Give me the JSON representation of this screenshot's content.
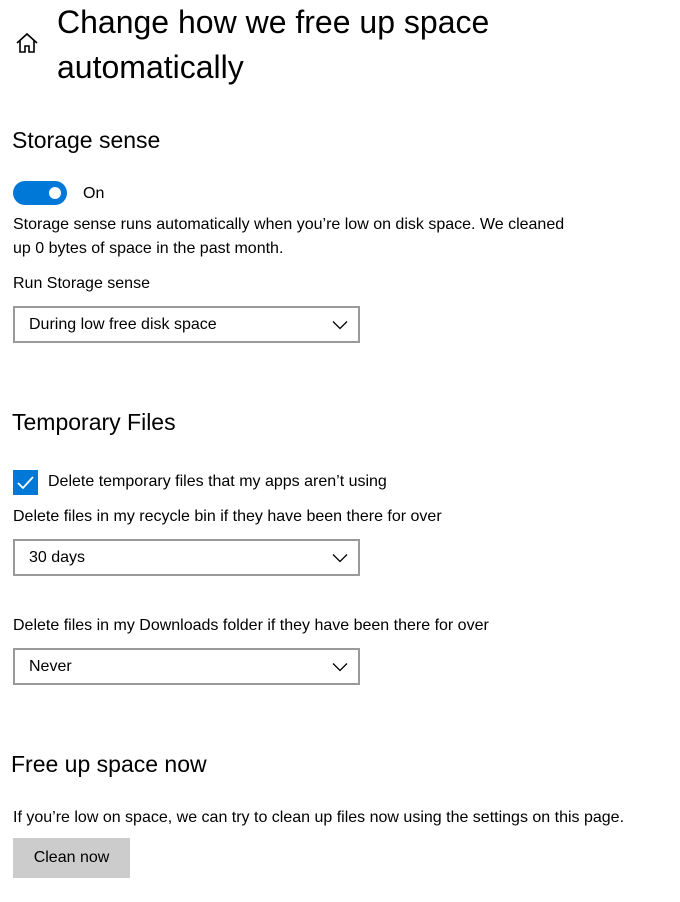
{
  "header": {
    "home_icon": "home-icon",
    "title": "Change how we free up space automatically"
  },
  "storage_sense": {
    "heading": "Storage sense",
    "toggle_state": "On",
    "toggle_on": true,
    "description": "Storage sense runs automatically when you’re low on disk space. We cleaned up 0 bytes of space in the past month.",
    "run_label": "Run Storage sense",
    "run_value": "During low free disk space"
  },
  "temporary_files": {
    "heading": "Temporary Files",
    "checkbox_label": "Delete temporary files that my apps aren’t using",
    "checkbox_checked": true,
    "recycle_label": "Delete files in my recycle bin if they have been there for over",
    "recycle_value": "30 days",
    "downloads_label": "Delete files in my Downloads folder if they have been there for over",
    "downloads_value": "Never"
  },
  "free_up": {
    "heading": "Free up space now",
    "description": "If you’re low on space, we can try to clean up files now using the settings on this page.",
    "button_label": "Clean now"
  },
  "colors": {
    "accent": "#0078d7",
    "button_bg": "#cccccc",
    "dropdown_border": "#9a9a9a"
  }
}
